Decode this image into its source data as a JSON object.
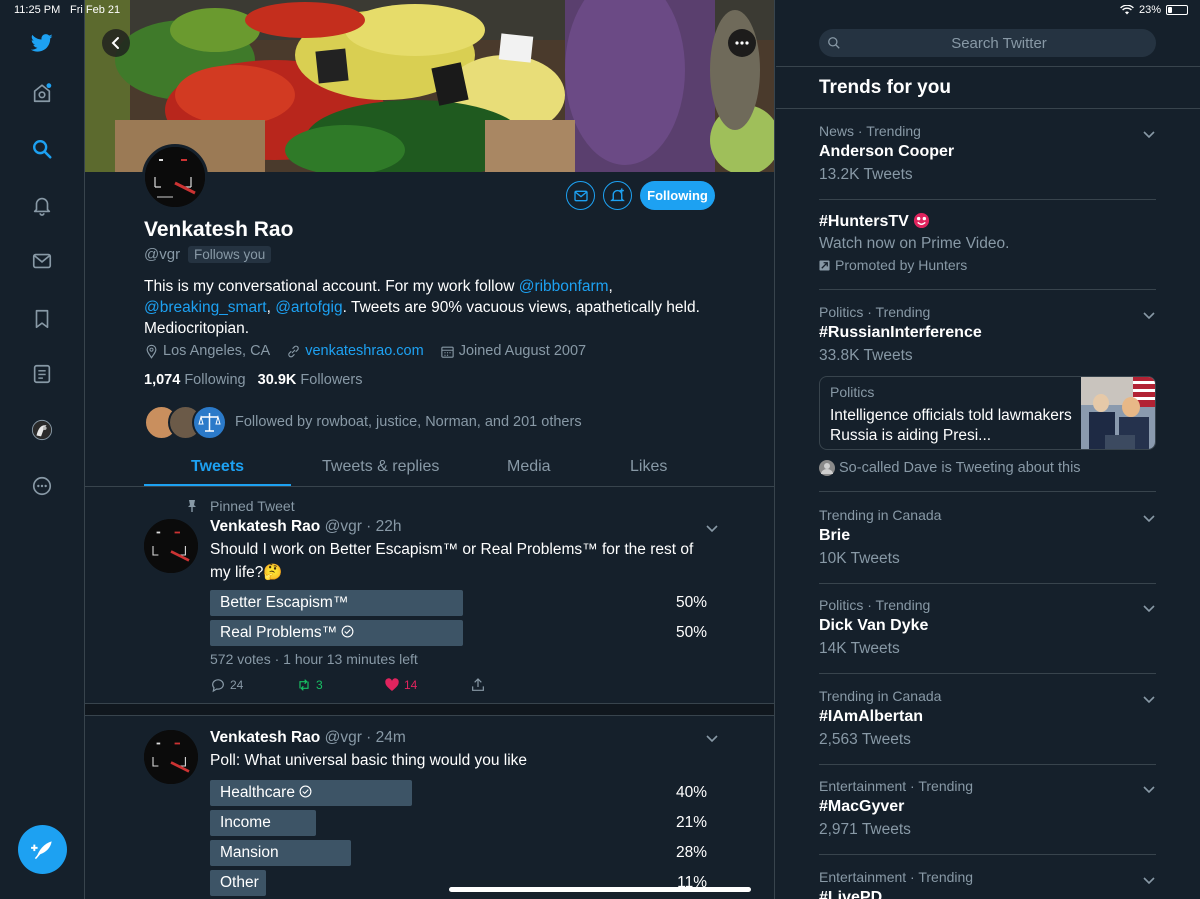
{
  "status_bar": {
    "time": "11:25 PM",
    "date": "Fri Feb 21",
    "battery": "23%",
    "battery_level": 0.23
  },
  "nav": {
    "items": [
      "twitter-logo",
      "home",
      "explore",
      "notifications",
      "messages",
      "bookmarks",
      "lists",
      "profile",
      "more"
    ],
    "active": "explore"
  },
  "profile": {
    "name": "Venkatesh Rao",
    "handle": "@vgr",
    "follows_you": "Follows you",
    "following_button": "Following",
    "bio_text_1": "This is my conversational account. For my work follow ",
    "bio_link_1": "@ribbonfarm",
    "bio_sep_1": ",",
    "bio_link_2": "@breaking_smart",
    "bio_sep_2": ", ",
    "bio_link_3": "@artofgig",
    "bio_text_2": ". Tweets are 90% vacuous views, apathetically held. Mediocritopian.",
    "location": "Los Angeles, CA",
    "website": "venkateshrao.com",
    "joined": "Joined August 2007",
    "following_count": "1,074",
    "following_label": "Following",
    "followers_count": "30.9K",
    "followers_label": "Followers",
    "followed_by": "Followed by rowboat, justice, Norman, and 201 others"
  },
  "tabs": [
    {
      "label": "Tweets",
      "active": true
    },
    {
      "label": "Tweets & replies",
      "active": false
    },
    {
      "label": "Media",
      "active": false
    },
    {
      "label": "Likes",
      "active": false
    }
  ],
  "tweets": [
    {
      "pinned_label": "Pinned Tweet",
      "author": "Venkatesh Rao",
      "meta": "@vgr · 22h",
      "text": "Should I work on Better Escapism™ or Real Problems™ for the rest of my life?🤔",
      "poll": [
        {
          "label": "Better Escapism™",
          "pct": "50%",
          "fraction": 0.5,
          "winner": false
        },
        {
          "label": "Real Problems™",
          "pct": "50%",
          "fraction": 0.5,
          "winner": true
        }
      ],
      "poll_meta": "572 votes · 1 hour 13 minutes left",
      "replies": "24",
      "retweets": "3",
      "likes": "14"
    },
    {
      "author": "Venkatesh Rao",
      "meta": "@vgr · 24m",
      "text": "Poll: What universal basic thing would you like",
      "poll": [
        {
          "label": "Healthcare",
          "pct": "40%",
          "fraction": 0.4,
          "winner": true
        },
        {
          "label": "Income",
          "pct": "21%",
          "fraction": 0.21,
          "winner": false
        },
        {
          "label": "Mansion",
          "pct": "28%",
          "fraction": 0.28,
          "winner": false
        },
        {
          "label": "Other",
          "pct": "11%",
          "fraction": 0.11,
          "winner": false
        }
      ]
    }
  ],
  "search": {
    "placeholder": "Search Twitter"
  },
  "trends_title": "Trends for you",
  "trends": [
    {
      "context": "News · Trending",
      "name": "Anderson Cooper",
      "count": "13.2K Tweets"
    },
    {
      "context": "",
      "name": "#HuntersTV",
      "count": "Watch now on Prime Video.",
      "promoted": "Promoted by Hunters"
    },
    {
      "context": "Politics · Trending",
      "name": "#RussianInterference",
      "count": "33.8K Tweets"
    },
    {
      "context": "Trending in Canada",
      "name": "Brie",
      "count": "10K Tweets"
    },
    {
      "context": "Politics · Trending",
      "name": "Dick Van Dyke",
      "count": "14K Tweets"
    },
    {
      "context": "Trending in Canada",
      "name": "#IAmAlbertan",
      "count": "2,563 Tweets"
    },
    {
      "context": "Entertainment · Trending",
      "name": "#MacGyver",
      "count": "2,971 Tweets"
    },
    {
      "context": "Entertainment · Trending",
      "name": "#LivePD",
      "count": ""
    }
  ],
  "news_card": {
    "topic": "Politics",
    "headline": "Intelligence officials told lawmakers Russia is aiding Presi..."
  },
  "tweeting_about": "So-called Dave is Tweeting about this",
  "colors": {
    "background": "#15202b",
    "accent": "#1da1f2",
    "muted": "#8899a6",
    "border": "#38444d",
    "retweet": "#17bf63",
    "like": "#e0245e"
  }
}
